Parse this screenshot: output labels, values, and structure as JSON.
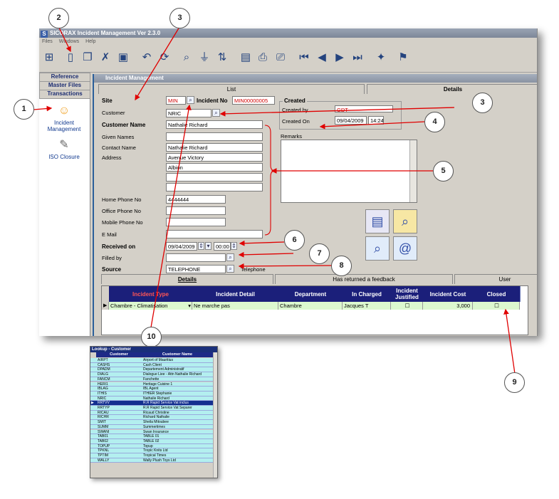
{
  "app_title": "SICORAX Incident Management Ver 2.3.0",
  "app_logo_letter": "S",
  "menu": [
    "Files",
    "Windows",
    "Help"
  ],
  "nav": {
    "headers": [
      "Reference",
      "Master Files",
      "Transactions"
    ],
    "items": [
      {
        "label": "Incident Management",
        "icon": "incident-icon"
      },
      {
        "label": "ISO Closure",
        "icon": "iso-closure-icon"
      }
    ]
  },
  "incident_window": {
    "title": "Incident Management",
    "tabs": [
      "List",
      "Details"
    ],
    "site": {
      "label": "Site",
      "value": "MIN"
    },
    "incident_no": {
      "label": "Incident No",
      "value": "MIN00000005"
    },
    "created": {
      "title": "Created",
      "by_label": "Created by",
      "by_value": "GDT",
      "on_label": "Created On",
      "date": "09/04/2009",
      "time": "14:24"
    },
    "customer": {
      "label": "Customer",
      "value": "NRIC"
    },
    "customer_name": {
      "label": "Customer Name",
      "value": "Nathalie Richard"
    },
    "given_names": {
      "label": "Given Names",
      "value": ""
    },
    "contact_name": {
      "label": "Contact Name",
      "value": "Nathalie Richard"
    },
    "address": {
      "label": "Address",
      "lines": [
        "Avenue Victory",
        "Albion",
        "",
        ""
      ]
    },
    "home_phone": {
      "label": "Home Phone No",
      "value": "4444444"
    },
    "office_phone": {
      "label": "Office Phone No",
      "value": ""
    },
    "mobile_phone": {
      "label": "Mobile Phone No",
      "value": ""
    },
    "email": {
      "label": "E Mail",
      "value": ""
    },
    "remarks": {
      "label": "Remarks",
      "value": ""
    },
    "received_on": {
      "label": "Received on",
      "date": "09/04/2009",
      "time": "00:00"
    },
    "filled_by": {
      "label": "Filled by",
      "value": ""
    },
    "source": {
      "label": "Source",
      "value": "TELEPHONE",
      "description": "Telephone"
    },
    "bottom_tabs": [
      "Details",
      "Has returned a feedback",
      "User"
    ],
    "grid": {
      "columns": [
        "Incident Type",
        "Incident Detail",
        "Department",
        "In Charged",
        "Incident Justified",
        "Incident Cost",
        "Closed"
      ],
      "rows": [
        {
          "type": "Chambre - Climatisation",
          "detail": "Ne marche pas",
          "department": "Chambre",
          "in_charged": "Jacques T",
          "justified": false,
          "cost": "3,000",
          "closed": false
        }
      ]
    }
  },
  "annotations": [
    "1",
    "2",
    "3",
    "3",
    "4",
    "5",
    "6",
    "7",
    "8",
    "9",
    "10"
  ],
  "lookup": {
    "title": "Lookup - Customer",
    "columns": [
      "Customer",
      "Customer Name"
    ],
    "rows": [
      [
        "AIRPT",
        "Airport of Mauritius"
      ],
      [
        "CASHS",
        "Cash Client"
      ],
      [
        "DPADM",
        "Departement Administratif"
      ],
      [
        "DIALG",
        "Dialogue Liee - Attn Nathalie Richard"
      ],
      [
        "FANCM",
        "Fanchette"
      ],
      [
        "HERI1",
        "Heritage Cuisine 1"
      ],
      [
        "IBLAG",
        "IBL Agent"
      ],
      [
        "ITHIS",
        "ITHIER Stephanie"
      ],
      [
        "NRIC",
        "Nathalie Richard"
      ],
      [
        "RRTVV",
        "R.R Rapid Service Vat inclus"
      ],
      [
        "RRTYP",
        "R.R Rapid Service Vat Separer"
      ],
      [
        "RICAU",
        "Ricaud Christine"
      ],
      [
        "RICHR",
        "Richard Nathalie"
      ],
      [
        "SMIT",
        "Sheila Mitoubee"
      ],
      [
        "SUMM",
        "Summertimes"
      ],
      [
        "SWANI",
        "Swan Insurance"
      ],
      [
        "TAB01",
        "TABLE 01"
      ],
      [
        "TAB02",
        "TABLE 02"
      ],
      [
        "TOPUP",
        "Topup"
      ],
      [
        "TPKNL",
        "Tropic Knits Ltd"
      ],
      [
        "TPTIM",
        "Tropical Times"
      ],
      [
        "WALLY",
        "Wally Plush Toys Ltd"
      ]
    ],
    "selected_index": 9
  },
  "colors": {
    "accent": "#1b1f7a",
    "annotation": "#e00000",
    "grid_row": "#dcf8cf",
    "lookup_row": "#b3efef"
  }
}
